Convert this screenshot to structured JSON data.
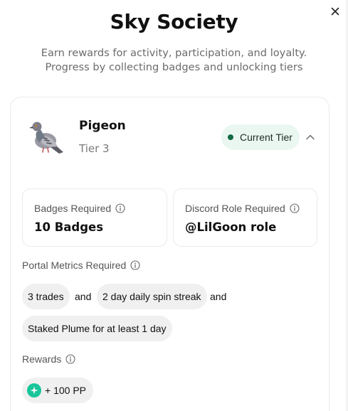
{
  "title": "Sky Society",
  "subtitle_line1": "Earn rewards for activity, participation, and loyalty.",
  "subtitle_line2": "Progress by collecting badges and unlocking tiers",
  "tier": {
    "name": "Pigeon",
    "level": "Tier 3",
    "status": "Current Tier",
    "icon": "pigeon-icon"
  },
  "requirements": {
    "badges_label": "Badges Required",
    "badges_value": "10 Badges",
    "discord_label": "Discord Role Required",
    "discord_value": "@LilGoon role"
  },
  "metrics": {
    "label": "Portal Metrics Required",
    "items": [
      "3 trades",
      "2 day daily spin streak",
      "Staked Plume for at least 1 day"
    ],
    "connector": "and"
  },
  "rewards": {
    "label": "Rewards",
    "items": [
      "+ 100 PP"
    ]
  },
  "colors": {
    "status_dot": "#136b45",
    "status_bg": "#eaf7f1",
    "pp_icon": "#19c59a"
  }
}
